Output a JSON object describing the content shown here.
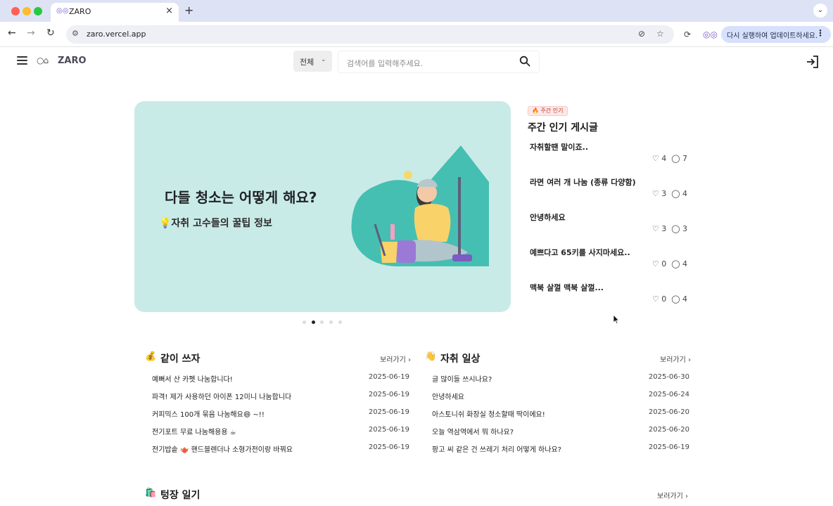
{
  "browser": {
    "tab_title": "ZARO",
    "tab_icon": "owl-icon",
    "url": "zaro.vercel.app",
    "update_button": "다시 실행하여 업데이트하세요."
  },
  "header": {
    "logo_text": "ZARO",
    "search_category": "전체",
    "search_placeholder": "검색어를 입력해주세요."
  },
  "banner": {
    "title": "다들 청소는 어떻게 해요?",
    "subtitle": "💡자취 고수들의 꿀팁 정보",
    "colors": {
      "background": "#c9ebe7",
      "accent": "#45bfb1"
    },
    "slide_count": 5,
    "active_slide": 2
  },
  "popular": {
    "badge": "🔥 주간 인기",
    "title": "주간 인기 게시글",
    "items": [
      {
        "title": "자취할땐 말이죠..",
        "likes": "4",
        "comments": "7"
      },
      {
        "title": "라면 여러 개 나눔 (종류 다양함)",
        "likes": "3",
        "comments": "4"
      },
      {
        "title": "안녕하세요",
        "likes": "3",
        "comments": "3"
      },
      {
        "title": "예쁘다고 65키를 사지마세요..",
        "likes": "0",
        "comments": "4"
      },
      {
        "title": "맥북 살껄 맥북 살껄...",
        "likes": "0",
        "comments": "4"
      }
    ]
  },
  "sections": [
    {
      "icon": "💰",
      "title": "같이 쓰자",
      "more": "보러가기",
      "rows": [
        {
          "title": "예뻐서 산 카펫 나눔합니다!",
          "date": "2025-06-19"
        },
        {
          "title": "파격! 제가 사용하던 아이폰 12미니 나눔합니다",
          "date": "2025-06-19"
        },
        {
          "title": "커피믹스 100개 묶음 나눔해요😄 ~!!",
          "date": "2025-06-19"
        },
        {
          "title": "전기포트 무료 나눔해용용 ☕",
          "date": "2025-06-19"
        },
        {
          "title": "전기밥솥 🫖 핸드블렌더나 소형가전이랑 바꿔요",
          "date": "2025-06-19"
        }
      ]
    },
    {
      "icon": "👋",
      "title": "자취 일상",
      "more": "보러가기",
      "rows": [
        {
          "title": "글 많이들 쓰시나요?",
          "date": "2025-06-30"
        },
        {
          "title": "안녕하세요",
          "date": "2025-06-24"
        },
        {
          "title": "아스토니쉬 화장실 청소할때 딱이에요!",
          "date": "2025-06-20"
        },
        {
          "title": "오늘 역삼역에서 뭐 하나요?",
          "date": "2025-06-20"
        },
        {
          "title": "팡고 씨 같은 건 쓰레기 처리 어떻게 하나요?",
          "date": "2025-06-19"
        }
      ]
    },
    {
      "icon": "🛍️",
      "title": "텅장 일기",
      "more": "보러가기",
      "rows": []
    }
  ]
}
